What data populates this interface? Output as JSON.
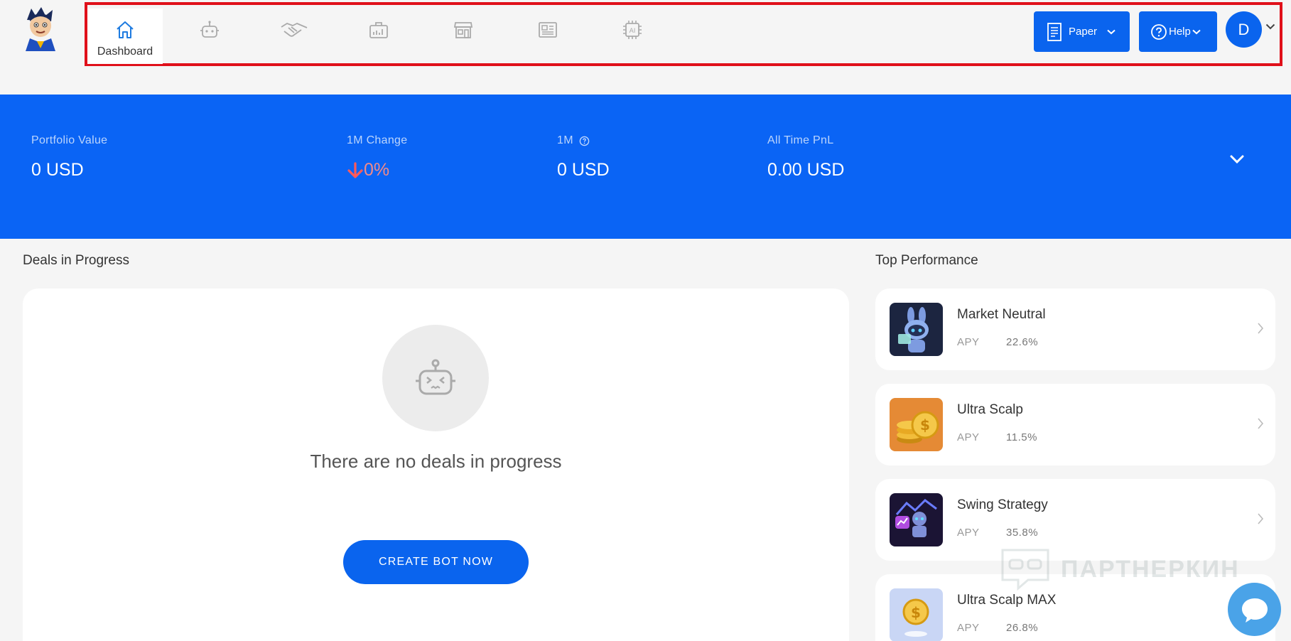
{
  "nav": {
    "items": [
      {
        "icon": "home-icon",
        "label": "Dashboard",
        "active": true
      },
      {
        "icon": "bot-icon",
        "label": ""
      },
      {
        "icon": "handshake-icon",
        "label": ""
      },
      {
        "icon": "briefcase-icon",
        "label": ""
      },
      {
        "icon": "store-icon",
        "label": ""
      },
      {
        "icon": "news-icon",
        "label": ""
      },
      {
        "icon": "ai-chip-icon",
        "label": ""
      }
    ],
    "paper_label": "Paper",
    "help_label": "Help",
    "avatar_initial": "D"
  },
  "stats": {
    "portfolio_label": "Portfolio Value",
    "portfolio_value": "0 USD",
    "change_label": "1M Change",
    "change_value": "0%",
    "m1_label": "1M",
    "m1_value": "0 USD",
    "pnl_label": "All Time PnL",
    "pnl_value": "0.00 USD"
  },
  "deals": {
    "title": "Deals in Progress",
    "empty_text": "There are no deals in progress",
    "create_button": "CREATE BOT NOW"
  },
  "performance": {
    "title": "Top Performance",
    "apy_label": "APY",
    "items": [
      {
        "name": "Market Neutral",
        "apy": "22.6%"
      },
      {
        "name": "Ultra Scalp",
        "apy": "11.5%"
      },
      {
        "name": "Swing Strategy",
        "apy": "35.8%"
      },
      {
        "name": "Ultra Scalp MAX",
        "apy": "26.8%"
      }
    ]
  },
  "watermark": "ПАРТНЕРКИН",
  "colors": {
    "primary": "#0a64ee",
    "band": "#0a64f5",
    "negative": "#f08a8a",
    "frame": "#e0101a"
  }
}
